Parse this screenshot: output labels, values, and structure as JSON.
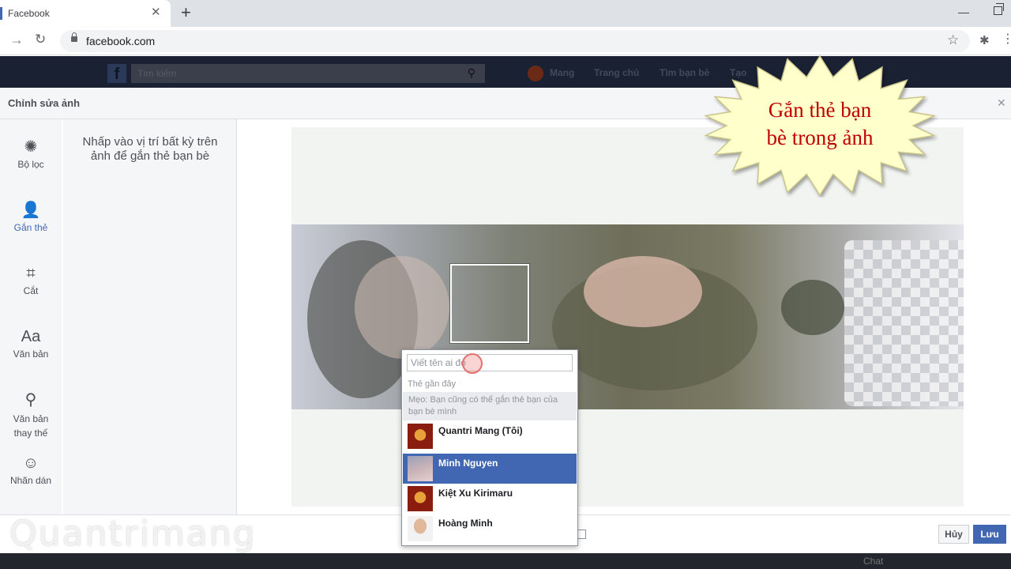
{
  "browser": {
    "tab_title": "Facebook",
    "url": "facebook.com"
  },
  "fb_bar": {
    "search_placeholder": "Tìm kiếm",
    "nav": [
      "Mang",
      "Trang chủ",
      "Tìm bạn bè",
      "Tạo"
    ]
  },
  "modal": {
    "title": "Chỉnh sửa ảnh",
    "tools": [
      {
        "label": "Bộ lọc",
        "icon": "filter-icon"
      },
      {
        "label": "Gắn thẻ",
        "icon": "tag-person-icon"
      },
      {
        "label": "Cắt",
        "icon": "crop-icon"
      },
      {
        "label": "Văn bản",
        "icon": "text-icon"
      },
      {
        "label": "Văn bản thay thế",
        "icon": "search-icon"
      },
      {
        "label": "Nhãn dán",
        "icon": "smiley-icon"
      }
    ],
    "active_tool": "Gắn thẻ",
    "panel_instruction": "Nhấp vào vị trí bất kỳ trên ảnh để gắn thẻ bạn bè",
    "tag_input_placeholder": "Viết tên ai đó",
    "recent_tags_label": "Thẻ gần đây",
    "tip": "Mẹo: Bạn cũng có thể gắn thẻ bạn của bạn bè mình",
    "friends": [
      {
        "name": "Quantri Mang (Tôi)",
        "selected": false
      },
      {
        "name": "Minh Nguyen",
        "selected": true
      },
      {
        "name": "Kiệt Xu Kirimaru",
        "selected": false
      },
      {
        "name": "Hoàng Minh",
        "selected": false
      }
    ],
    "cancel_label": "Hủy",
    "save_label": "Lưu"
  },
  "bottom": {
    "chat_label": "Chat"
  },
  "callout": {
    "line1": "Gắn thẻ bạn",
    "line2": "bè trong ảnh"
  },
  "watermark": "Quantrimang",
  "colors": {
    "accent": "#4267b2",
    "callout_text": "#c00000",
    "callout_fill": "#ffffcc"
  }
}
